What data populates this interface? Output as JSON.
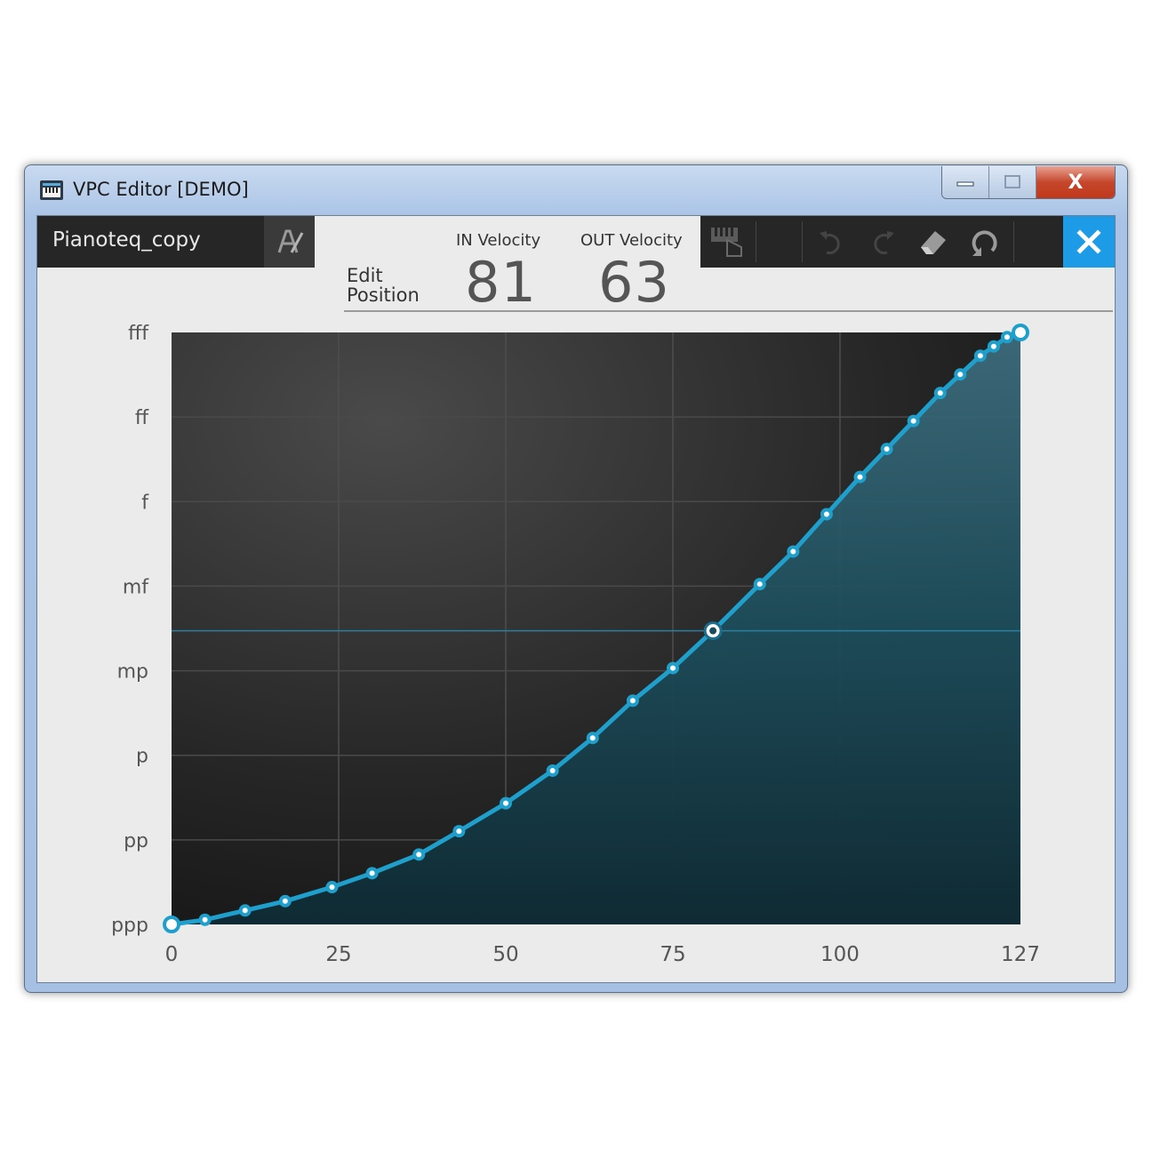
{
  "window": {
    "title": "VPC Editor [DEMO]",
    "buttons": {
      "minimize_icon": "minimize-icon",
      "maximize_icon": "maximize-icon",
      "close_label": "X"
    }
  },
  "editor": {
    "preset_name": "Pianoteq_copy",
    "edit_position_label": "Edit Position",
    "in_velocity": {
      "label": "IN Velocity",
      "value": "81"
    },
    "out_velocity": {
      "label": "OUT Velocity",
      "value": "63"
    },
    "toolbar": [
      "keyboard-touch-icon",
      "undo-icon",
      "redo-icon",
      "eraser-icon",
      "reset-icon"
    ],
    "close_icon": "close-icon"
  },
  "chart_data": {
    "type": "line",
    "xlim": [
      0,
      127
    ],
    "x_ticks": [
      "0",
      "25",
      "50",
      "75",
      "100",
      "127"
    ],
    "y_ticks": [
      "ppp",
      "pp",
      "p",
      "mp",
      "mf",
      "f",
      "ff",
      "fff"
    ],
    "ylim": [
      0,
      127
    ],
    "grid": true,
    "colors": {
      "curve": "#1fa0cc",
      "fill": "#1d4c5a",
      "background": "#2a2a2a"
    },
    "series": [
      {
        "x": [
          0,
          5,
          11,
          17,
          24,
          30,
          37,
          43,
          50,
          57,
          63,
          69,
          75,
          81,
          88,
          93,
          98,
          103,
          107,
          111,
          115,
          118,
          121,
          123,
          125,
          127
        ],
        "y": [
          0,
          1,
          3,
          5,
          8,
          11,
          15,
          20,
          26,
          33,
          40,
          48,
          55,
          63,
          73,
          80,
          88,
          96,
          102,
          108,
          114,
          118,
          122,
          124,
          126,
          127
        ]
      }
    ],
    "selected_point": {
      "x": 81,
      "y": 63
    }
  }
}
